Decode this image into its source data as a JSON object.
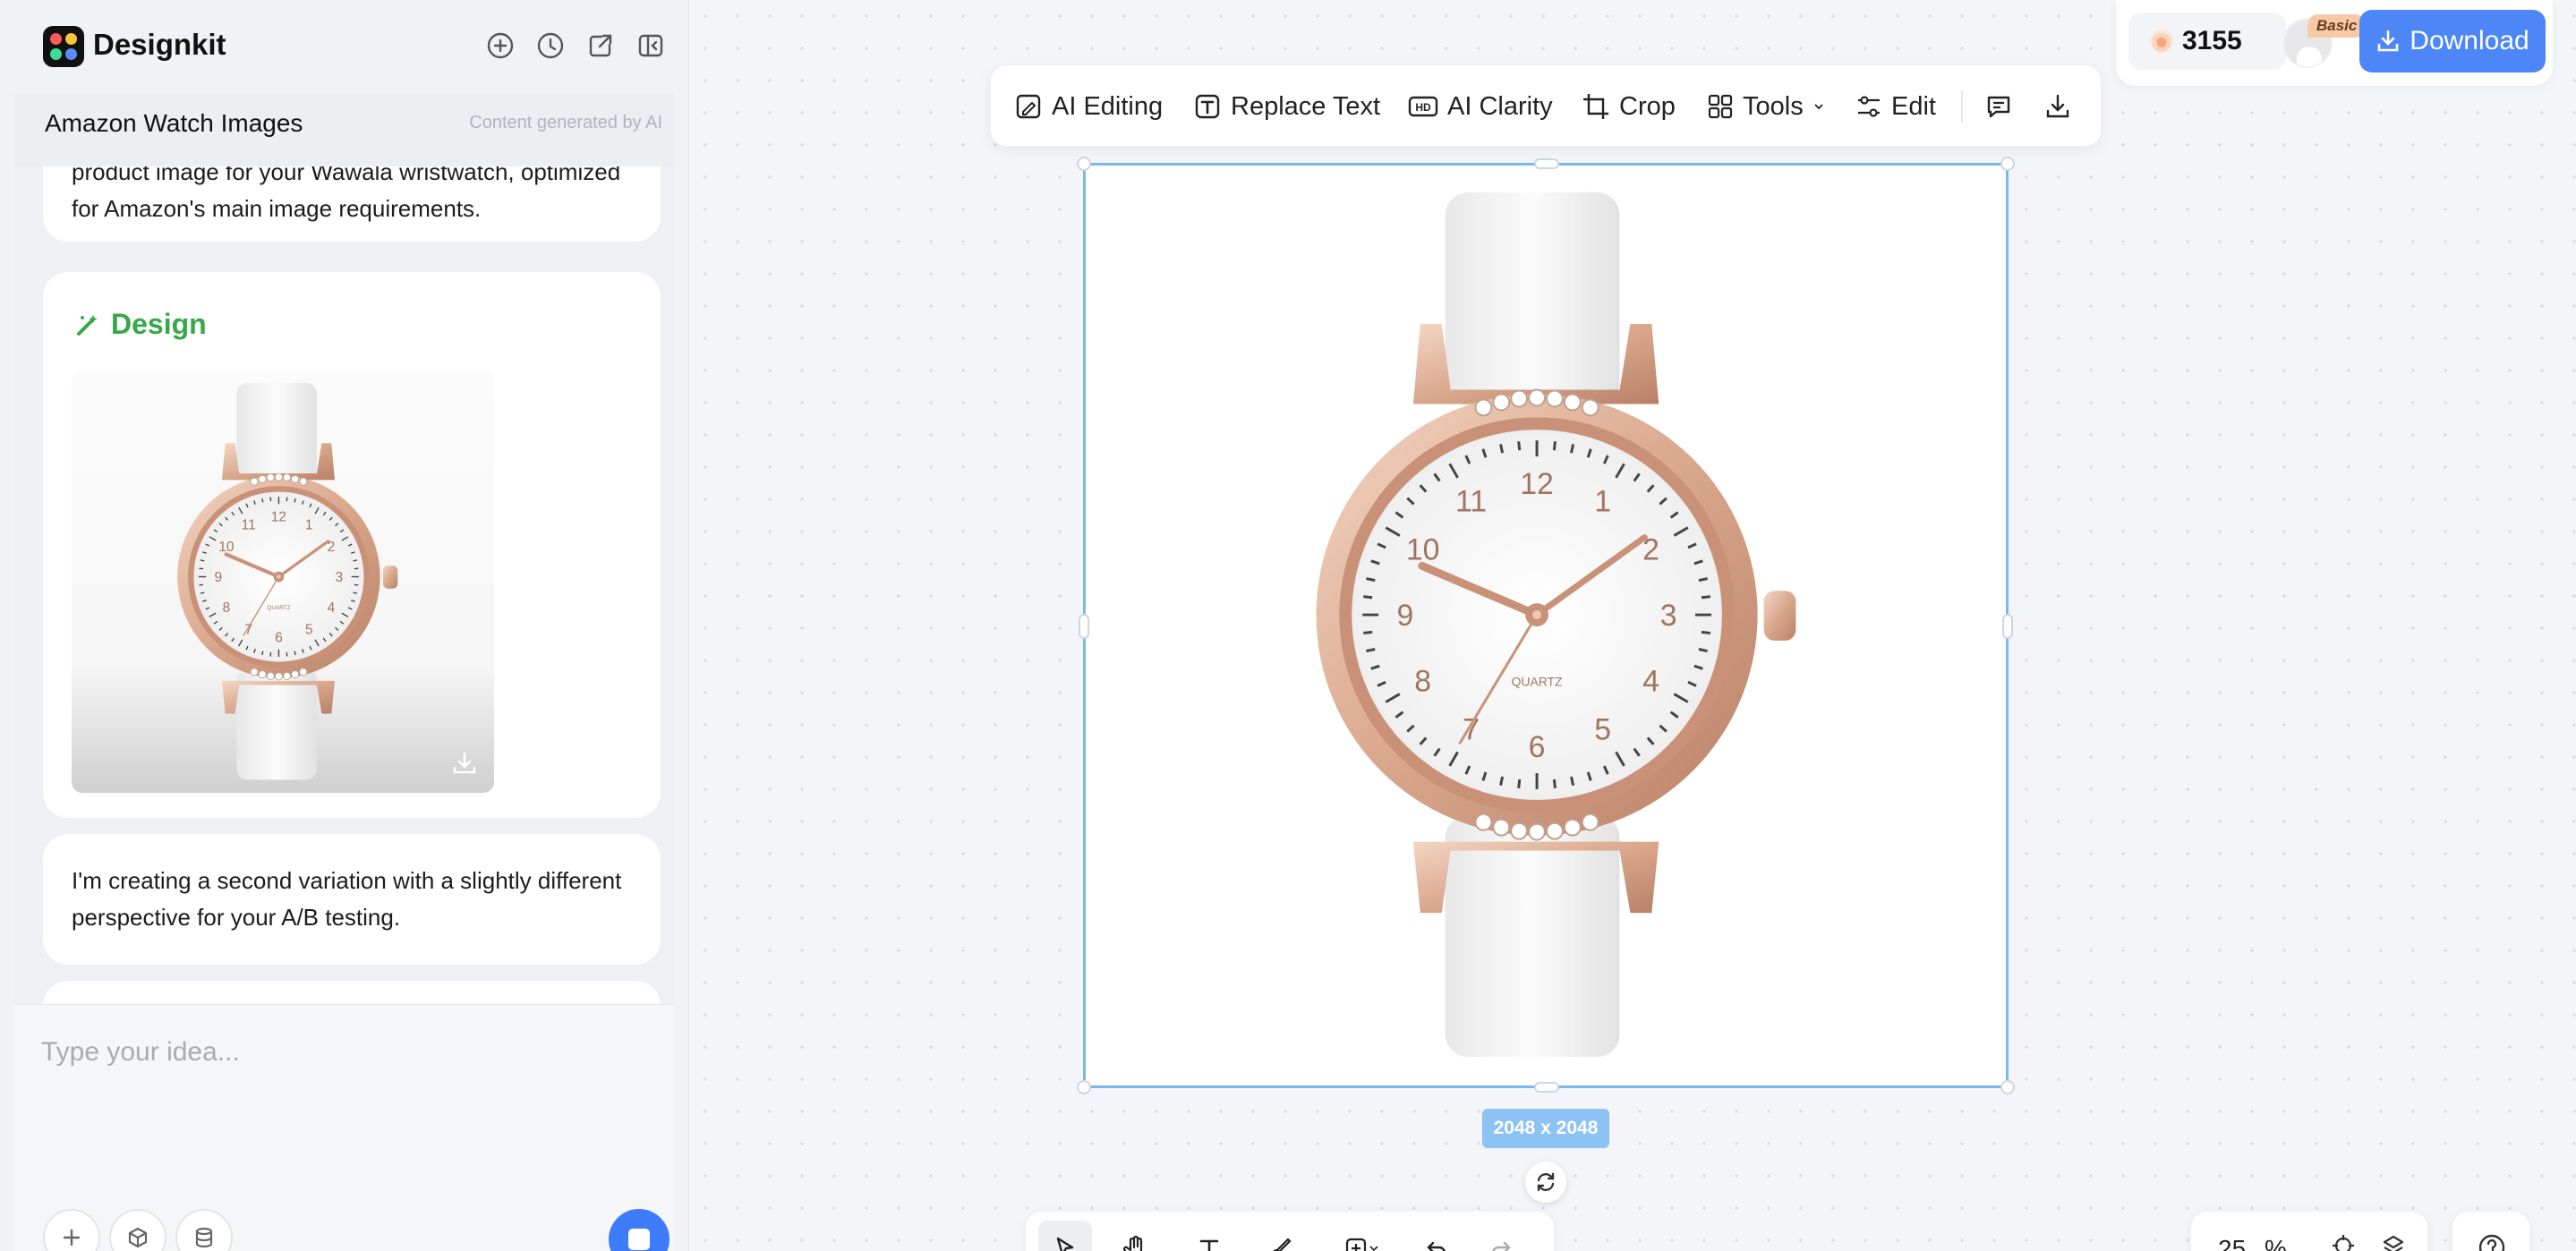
{
  "app": {
    "name": "Designkit"
  },
  "chat": {
    "title": "Amazon Watch Images",
    "ai_note": "Content generated by AI",
    "messages": [
      "product image for your Wawala wristwatch, optimized for Amazon's main image requirements.",
      "I'm creating a second variation with a slightly different perspective for your A/B testing."
    ],
    "design_label": "Design",
    "input_placeholder": "Type your idea..."
  },
  "toolbar": {
    "ai_editing": "AI Editing",
    "replace_text": "Replace Text",
    "ai_clarity": "AI Clarity",
    "crop": "Crop",
    "tools": "Tools",
    "edit": "Edit"
  },
  "account": {
    "credits": "3155",
    "plan_badge": "Basic",
    "download_label": "Download"
  },
  "canvas": {
    "dimensions_label": "2048 x 2048",
    "zoom_value": "25",
    "zoom_unit": "%"
  },
  "watch_dial": {
    "numbers": [
      "12",
      "1",
      "2",
      "3",
      "4",
      "5",
      "6",
      "7",
      "8",
      "9",
      "10",
      "11"
    ],
    "brand_text": "QUARTZ"
  },
  "colors": {
    "accent_blue": "#4d86f7",
    "design_green": "#37a84a",
    "selection_border": "#7cb6ee",
    "rose_gold": "#e3b9a0"
  }
}
